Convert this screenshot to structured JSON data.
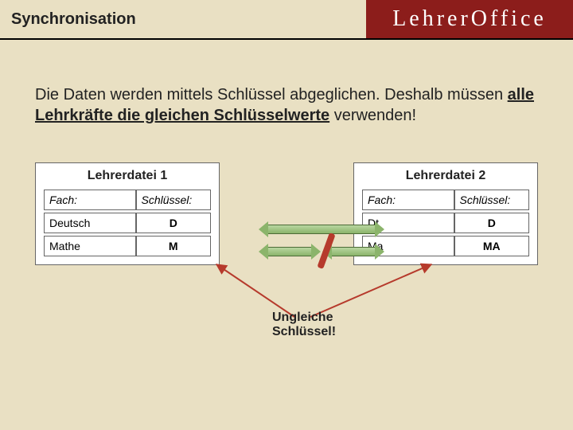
{
  "header": {
    "title": "Synchronisation",
    "brand_a": "Lehrer",
    "brand_b": "Office"
  },
  "intro": {
    "part1": "Die Daten werden mittels Schlüssel abgeglichen. Deshalb müssen ",
    "bold": "alle Lehrkräfte die gleichen Schlüsselwerte",
    "part2": " verwenden!"
  },
  "card1": {
    "title": "Lehrerdatei 1",
    "col_fach": "Fach:",
    "col_key": "Schlüssel:",
    "rows": [
      {
        "fach": "Deutsch",
        "key": "D"
      },
      {
        "fach": "Mathe",
        "key": "M"
      }
    ]
  },
  "card2": {
    "title": "Lehrerdatei 2",
    "col_fach": "Fach:",
    "col_key": "Schlüssel:",
    "rows": [
      {
        "fach": "Dt",
        "key": "D"
      },
      {
        "fach": "Ma",
        "key": "MA"
      }
    ]
  },
  "warning": {
    "line1": "Ungleiche",
    "line2": "Schlüssel!"
  },
  "colors": {
    "bg": "#e9e0c3",
    "brand": "#8c1d1b",
    "arrow": "#8bb46b",
    "warn": "#b63a2c"
  }
}
